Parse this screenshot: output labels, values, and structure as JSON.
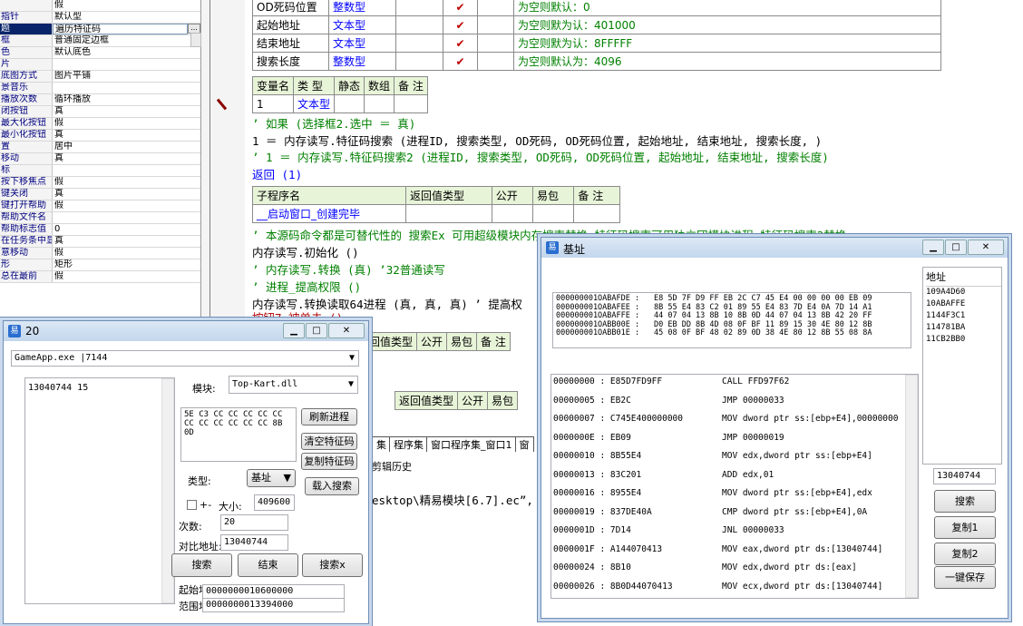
{
  "properties": [
    {
      "name": "",
      "value": "假"
    },
    {
      "name": "指针",
      "value": "默认型"
    },
    {
      "name": "题",
      "value": "遍历特征码",
      "selected": true
    },
    {
      "name": "框",
      "value": "普通固定边框"
    },
    {
      "name": "色",
      "value": "默认底色"
    },
    {
      "name": "片",
      "value": ""
    },
    {
      "name": "底图方式",
      "value": "图片平铺"
    },
    {
      "name": "景音乐",
      "value": ""
    },
    {
      "name": "播放次数",
      "value": "循环播放"
    },
    {
      "name": "闭按钮",
      "value": "真"
    },
    {
      "name": "最大化按钮",
      "value": "假"
    },
    {
      "name": "最小化按钮",
      "value": "真"
    },
    {
      "name": "置",
      "value": "居中"
    },
    {
      "name": "移动",
      "value": "真"
    },
    {
      "name": "标",
      "value": ""
    },
    {
      "name": "按下移焦点",
      "value": "假"
    },
    {
      "name": "键关闭",
      "value": "真"
    },
    {
      "name": "键打开帮助",
      "value": "假"
    },
    {
      "name": "帮助文件名",
      "value": ""
    },
    {
      "name": "帮助标志值",
      "value": "0"
    },
    {
      "name": "在任务条中显示",
      "value": "真"
    },
    {
      "name": "意移动",
      "value": "假"
    },
    {
      "name": "形",
      "value": "矩形"
    },
    {
      "name": "总在最前",
      "value": "假"
    }
  ],
  "param_table": {
    "rows": [
      {
        "name": "OD死码位置",
        "type": "整数型",
        "check": "✔",
        "note": "为空则默认：0"
      },
      {
        "name": "起始地址",
        "type": "文本型",
        "check": "✔",
        "note": "为空则默为认：401000"
      },
      {
        "name": "结束地址",
        "type": "文本型",
        "check": "✔",
        "note": "为空则默为认：8FFFFF"
      },
      {
        "name": "搜索长度",
        "type": "整数型",
        "check": "✔",
        "note": "为空则默认为：4096"
      }
    ]
  },
  "var_table": {
    "headers": [
      "变量名",
      "类 型",
      "静态",
      "数组",
      "备 注"
    ],
    "row": [
      "1",
      "文本型",
      "",
      "",
      ""
    ]
  },
  "code_lines": [
    {
      "text": "’ 如果 (选择框2.选中 ＝ 真)",
      "cls": "green"
    },
    {
      "text": "1 ＝ 内存读写.特征码搜索 (进程ID, 搜索类型, OD死码, OD死码位置, 起始地址, 结束地址, 搜索长度, )",
      "cls": ""
    },
    {
      "text": "’ 1 ＝ 内存读写.特征码搜索2 (进程ID, 搜索类型, OD死码, OD死码位置, 起始地址, 结束地址, 搜索长度)",
      "cls": "green"
    },
    {
      "text": "返回 (1)",
      "cls": "blue"
    }
  ],
  "sub_table": {
    "headers": [
      "子程序名",
      "返回值类型",
      "公开",
      "易包",
      "备 注"
    ],
    "name": "__启动窗口_创建完毕"
  },
  "code_lines2": [
    {
      "text": "’ 本源码命令都是可替代性的 搜索Ex 可用超级模块内存搜索替换 特征码搜索可用独立团模块进程_特征码搜索2替换",
      "cls": "green"
    },
    {
      "text": "内存读写.初始化 ()",
      "cls": ""
    },
    {
      "text": "’ 内存读写.转换 (真) ’32普通读写",
      "cls": "green"
    },
    {
      "text": "’ 进程_提高权限 ()",
      "cls": "green"
    },
    {
      "text": "内存读写.转换读取64进程 (真, 真, 真) ’ 提高权",
      "cls": ""
    }
  ],
  "line_partial": "按钮7_被单击 ()",
  "editor_tabs": [
    "集",
    "程序集",
    "窗口程序集_窗口1",
    "窗"
  ],
  "cut_history": "剪辑历史",
  "path_text": "esktop\\精易模块[6.7].ec”, 版",
  "second_table": {
    "headers": [
      "返回值类型",
      "公开",
      "易包",
      "备 注"
    ]
  },
  "third_table": {
    "headers": [
      "返回值类型",
      "公开",
      "易包"
    ]
  },
  "win20": {
    "title": "20",
    "process": "GameApp.exe   |7144",
    "list_item": "13040744   15",
    "module_label": "模块:",
    "module_value": "Top-Kart.dll",
    "hex_bytes": "5E C3 CC CC CC CC CC CC CC CC CC CC CC 8B 0D",
    "refresh": "刷新进程",
    "clear": "清空特征码",
    "copy": "复制特征码",
    "type_label": "类型:",
    "type_value": "基址",
    "load": "载入搜索",
    "plusminus": "+-",
    "size_label": "大小:",
    "size_value": "409600",
    "count_label": "次数:",
    "count_value": "20",
    "cmp_label": "对比地址:",
    "cmp_value": "13040744",
    "search": "搜索",
    "end": "结束",
    "searchx": "搜索x",
    "start_label": "起始地址:",
    "start_value": "0000000010600000",
    "range_label": "范围地址:",
    "range_value": "0000000013394000"
  },
  "winbase": {
    "title": "基址",
    "hexdump": [
      {
        "addr": "000000001OABAFDE :",
        "bytes": "E8 5D 7F D9 FF EB 2C C7 45 E4 00 00 00 00 EB 09"
      },
      {
        "addr": "000000001OABAFEE :",
        "bytes": "8B 55 E4 83 C2 01 89 55 E4 83 7D E4 0A 7D 14 A1"
      },
      {
        "addr": "000000001OABAFFE :",
        "bytes": "44 07 04 13 8B 10 8B 0D 44 07 04 13 8B 42 20 FF"
      },
      {
        "addr": "000000001OABB00E :",
        "bytes": "D0 EB DD 8B 4D 08 0F BF 11 89 15 30 4E 80 12 8B"
      },
      {
        "addr": "000000001OABB01E :",
        "bytes": "45 08 0F BF 48 02 89 0D 38 4E 80 12 8B 55 08 8A"
      }
    ],
    "disasm": [
      {
        "a": "00000000 : E85D7FD9FF",
        "i": "CALL FFD97F62"
      },
      {
        "a": "00000005 : EB2C",
        "i": "JMP 00000033"
      },
      {
        "a": "00000007 : C745E400000000",
        "i": "MOV dword ptr ss:[ebp+E4],00000000"
      },
      {
        "a": "0000000E : EB09",
        "i": "JMP 00000019"
      },
      {
        "a": "00000010 : 8B55E4",
        "i": "MOV edx,dword ptr ss:[ebp+E4]"
      },
      {
        "a": "00000013 : 83C201",
        "i": "ADD edx,01"
      },
      {
        "a": "00000016 : 8955E4",
        "i": "MOV dword ptr ss:[ebp+E4],edx"
      },
      {
        "a": "00000019 : 837DE40A",
        "i": "CMP dword ptr ss:[ebp+E4],0A"
      },
      {
        "a": "0000001D : 7D14",
        "i": "JNL 00000033"
      },
      {
        "a": "0000001F : A144070413",
        "i": "MOV eax,dword ptr ds:[13040744]"
      },
      {
        "a": "00000024 : 8B10",
        "i": "MOV edx,dword ptr ds:[eax]"
      },
      {
        "a": "00000026 : 8B0D44070413",
        "i": "MOV ecx,dword ptr ds:[13040744]"
      }
    ],
    "addr_header": "地址",
    "addr_list": [
      "109A4D60",
      "10ABAFFE",
      "1144F3C1",
      "114781BA",
      "11CB2BB0"
    ],
    "addr_value": "13040744",
    "search": "搜索",
    "copy1": "复制1",
    "copy2": "复制2",
    "save": "一键保存"
  }
}
